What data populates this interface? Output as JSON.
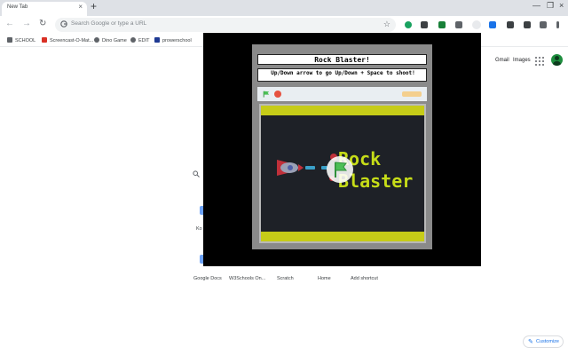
{
  "browser": {
    "tab": {
      "title": "New Tab",
      "close_icon": "×"
    },
    "new_tab_icon": "+",
    "window_controls": {
      "minimize": "—",
      "restore": "❐",
      "close": "×"
    },
    "nav": {
      "back": "←",
      "forward": "→",
      "reload": "↻"
    },
    "omnibox": {
      "placeholder": "Search Google or type a URL",
      "star": "☆"
    }
  },
  "bookmarks": [
    {
      "label": "SCHOOL",
      "color": "#5f6368"
    },
    {
      "label": "Screencast-O-Mat...",
      "color": "#d93025"
    },
    {
      "label": "Dino Game",
      "color": "#5f6368"
    },
    {
      "label": "EDIT",
      "color": "#5f6368"
    },
    {
      "label": "prowerschool",
      "color": "#1f3a93"
    }
  ],
  "ntp": {
    "gmail": "Gmail",
    "images": "Images",
    "partial_label": "Ko",
    "shortcuts": [
      "Google Docs",
      "W3Schools On...",
      "Scratch",
      "Home",
      "Add shortcut"
    ],
    "customize_icon": "✎",
    "customize": "Customize"
  },
  "game": {
    "title": "Rock Blaster!",
    "instructions": "Up/Down arrow to go Up/Down + Space to shoot!",
    "logo_line1": "Rock",
    "logo_line2": "Blaster"
  },
  "colors": {
    "overlay_bg": "#000000",
    "stage_frame": "#8a8a8a",
    "game_bg": "#1e2127",
    "band": "#c6cc18",
    "logo": "#c6dc18",
    "bullet": "#3aa0c8",
    "ship": "#c0303a",
    "flag_green": "#4cbf56"
  }
}
